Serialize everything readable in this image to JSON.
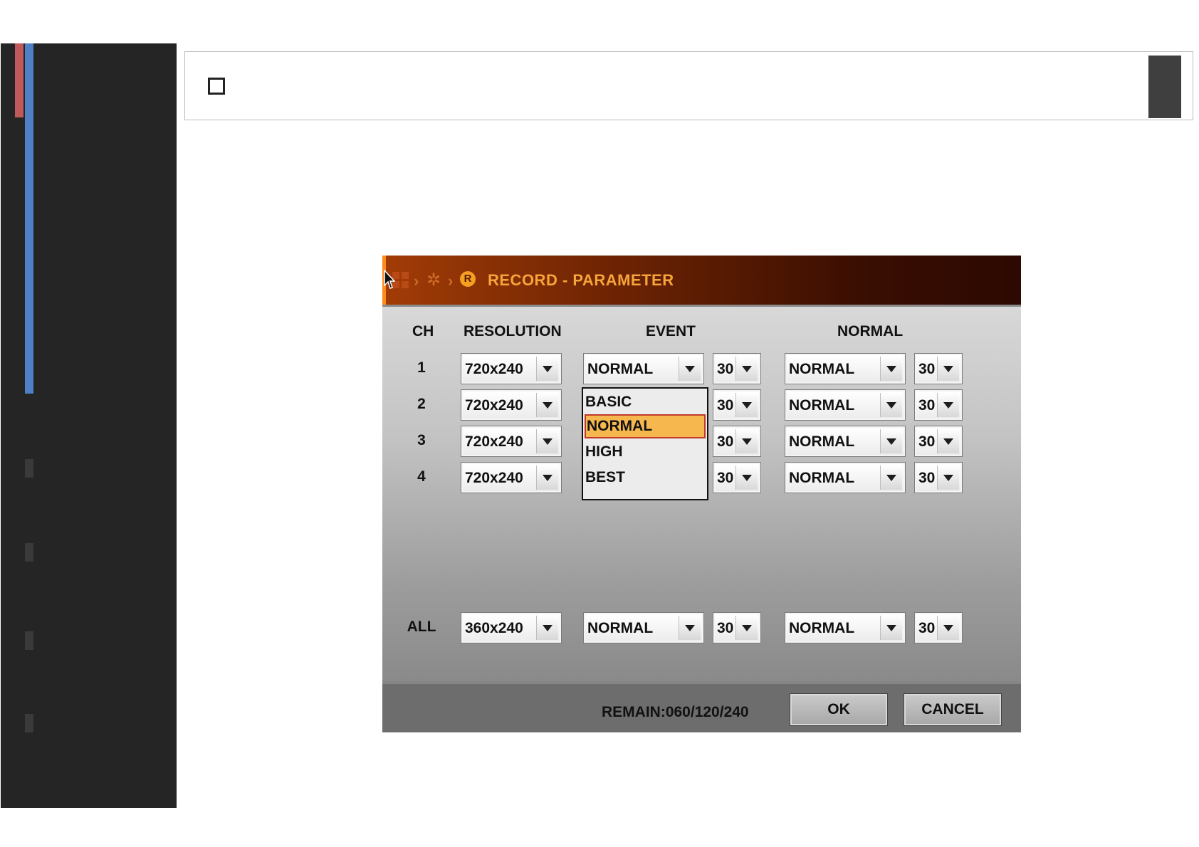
{
  "dialog": {
    "title": "RECORD - PARAMETER",
    "icons": [
      "grid-menu-icon",
      "chevron-right-icon",
      "gear-icon",
      "record-icon"
    ],
    "record_icon_letter": "R",
    "header_accent": "#f7a43a",
    "columns": {
      "ch": "CH",
      "resolution": "RESOLUTION",
      "event": "EVENT",
      "normal": "NORMAL"
    },
    "rows": [
      {
        "ch": "1",
        "resolution": "720x240",
        "event_quality": "NORMAL",
        "event_fps": "30",
        "normal_quality": "NORMAL",
        "normal_fps": "30"
      },
      {
        "ch": "2",
        "resolution": "720x240",
        "event_quality": "NORMAL",
        "event_fps": "30",
        "normal_quality": "NORMAL",
        "normal_fps": "30"
      },
      {
        "ch": "3",
        "resolution": "720x240",
        "event_quality": "NORMAL",
        "event_fps": "30",
        "normal_quality": "NORMAL",
        "normal_fps": "30"
      },
      {
        "ch": "4",
        "resolution": "720x240",
        "event_quality": "NORMAL",
        "event_fps": "30",
        "normal_quality": "NORMAL",
        "normal_fps": "30"
      }
    ],
    "all_row": {
      "label": "ALL",
      "resolution": "360x240",
      "event_quality": "NORMAL",
      "event_fps": "30",
      "normal_quality": "NORMAL",
      "normal_fps": "30"
    },
    "dropdown": {
      "options": [
        "BASIC",
        "NORMAL",
        "HIGH",
        "BEST"
      ],
      "selected": "NORMAL",
      "selection_color": "#f6b74f"
    },
    "remain": "REMAIN:060/120/240",
    "ok_label": "OK",
    "cancel_label": "CANCEL"
  }
}
